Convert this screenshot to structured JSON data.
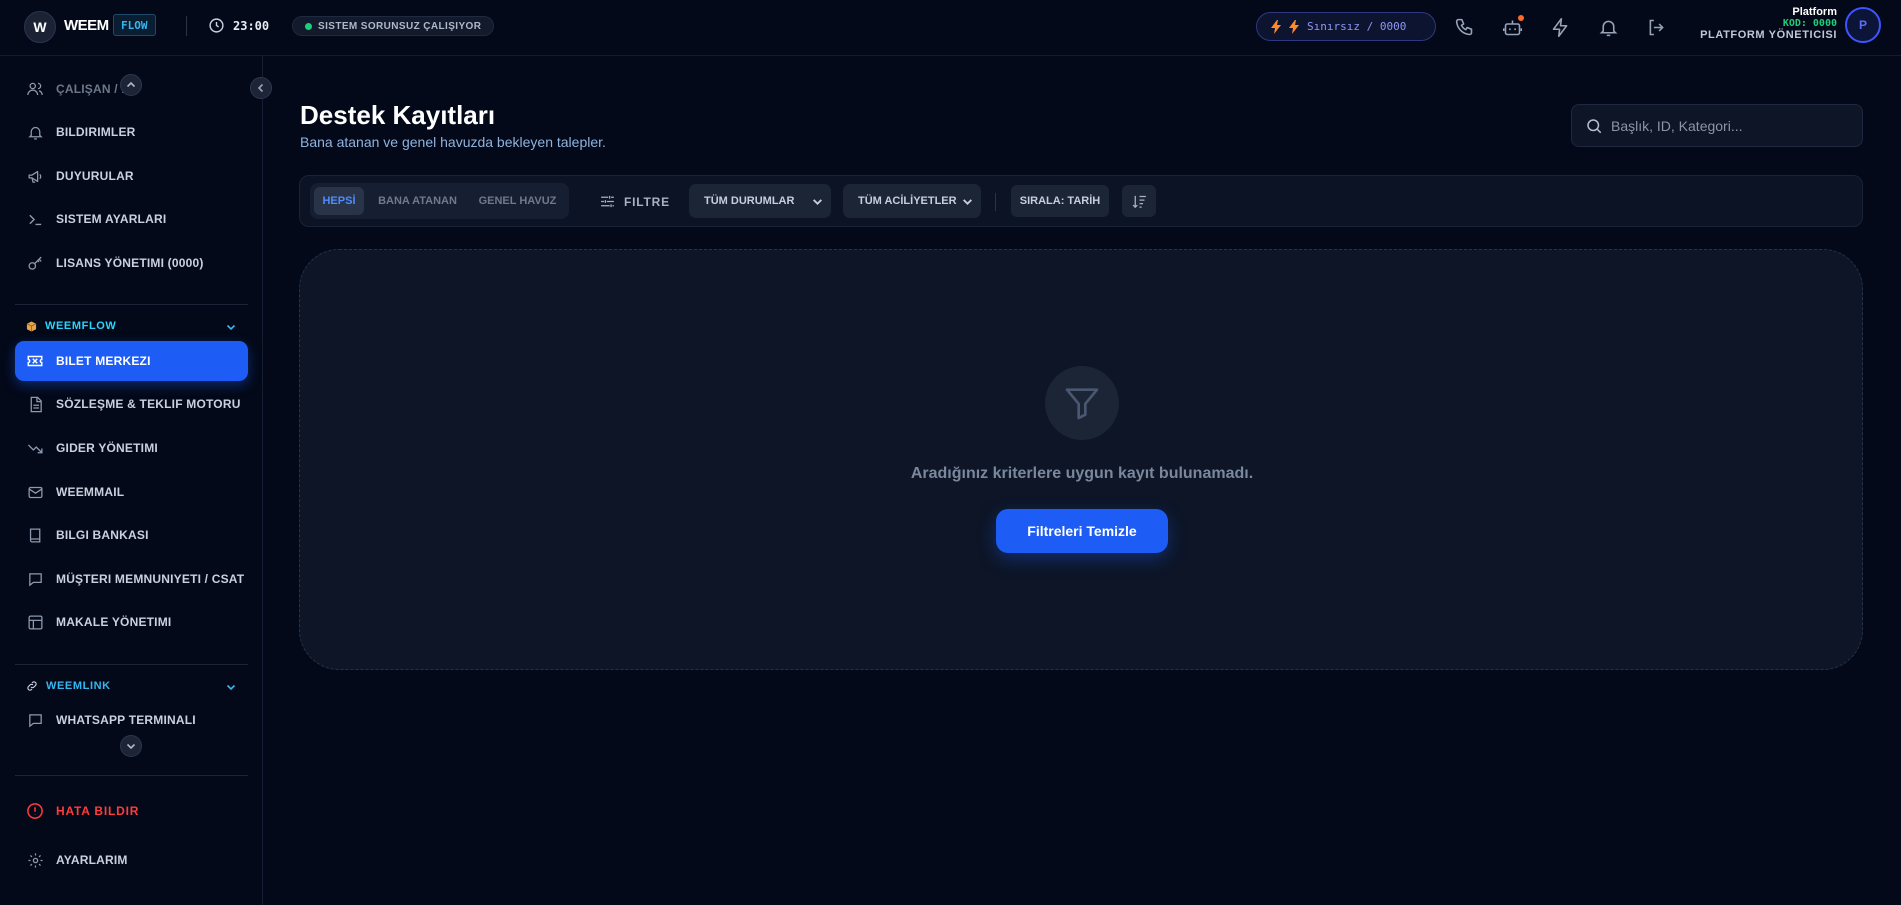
{
  "brand": {
    "badge_letter": "W",
    "name": "WEEM",
    "tag": "FLOW",
    "accent": "#1d5cf5"
  },
  "topbar": {
    "time": "23:00",
    "status": "SISTEM SORUNSUZ ÇALIŞIYOR",
    "status_color": "#1fce7a",
    "credit": "Sınırsız / 0000",
    "icons": [
      "phone-icon",
      "bot-icon",
      "lightning-icon",
      "bell-icon",
      "logout-icon"
    ],
    "user": {
      "name": "Platform",
      "code": "KOD: 0000",
      "role": "PLATFORM YÖNETICISI",
      "avatar_letter": "P"
    }
  },
  "sidebar": {
    "top_items": [
      {
        "label": "ÇALIŞAN / E",
        "icon": "users-icon"
      },
      {
        "label": "BILDIRIMLER",
        "icon": "bell-icon"
      },
      {
        "label": "DUYURULAR",
        "icon": "megaphone-icon"
      },
      {
        "label": "SISTEM AYARLARI",
        "icon": "terminal-icon"
      },
      {
        "label": "LISANS YÖNETIMI (0000)",
        "icon": "key-icon"
      }
    ],
    "weemflow": {
      "title": "WEEMFLOW",
      "items": [
        {
          "label": "BILET MERKEZI",
          "icon": "ticket-icon",
          "active": true
        },
        {
          "label": "SÖZLEŞME & TEKLIF MOTORU",
          "icon": "document-icon"
        },
        {
          "label": "GIDER YÖNETIMI",
          "icon": "trend-down-icon"
        },
        {
          "label": "WEEMMAIL",
          "icon": "mail-icon"
        },
        {
          "label": "BILGI BANKASI",
          "icon": "book-icon"
        },
        {
          "label": "MÜŞTERI MEMNUNIYETI / CSAT",
          "icon": "chat-icon"
        },
        {
          "label": "MAKALE YÖNETIMI",
          "icon": "layout-icon"
        }
      ]
    },
    "weemlink": {
      "title": "WEEMLINK",
      "items": [
        {
          "label": "WHATSAPP TERMINALI",
          "icon": "chat-icon"
        }
      ]
    },
    "report_bug": "HATA BILDIR",
    "settings": "AYARLARIM"
  },
  "main": {
    "title": "Destek Kayıtları",
    "subtitle": "Bana atanan ve genel havuzda bekleyen talepler.",
    "search_placeholder": "Başlık, ID, Kategori...",
    "tabs": [
      "HEPSİ",
      "BANA ATANAN",
      "GENEL HAVUZ"
    ],
    "active_tab": 0,
    "filter_label": "FILTRE",
    "status_select": "TÜM DURUMLAR",
    "urgency_select": "TÜM ACİLİYETLER",
    "sort_label": "SIRALA: TARİH",
    "empty_message": "Aradığınız kriterlere uygun kayıt bulunamadı.",
    "clear_button": "Filtreleri Temizle"
  }
}
